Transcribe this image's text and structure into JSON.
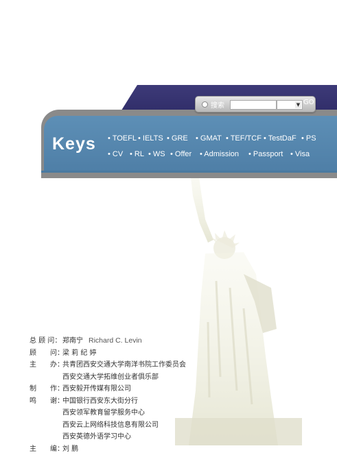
{
  "search": {
    "label": "搜索",
    "input_value": "",
    "select_value": "",
    "go_label": "GO"
  },
  "banner": {
    "title": "Keys",
    "nav_row1": [
      "• TOEFL",
      "• IELTS",
      "• GRE",
      "• GMAT",
      "• TEF/TCF",
      "• TestDaF",
      "• PS"
    ],
    "nav_row2": [
      "• CV",
      "• RL",
      "• WS",
      "• Offer",
      "• Admission",
      "• Passport",
      "• Visa"
    ]
  },
  "credits": [
    {
      "label": "总 顾 问：",
      "value": "郑南宁",
      "extra": "Richard C. Levin"
    },
    {
      "label": "顾　　问：",
      "value": "梁  莉  纪  婷",
      "extra": ""
    },
    {
      "label": "主　　办：",
      "value": "共青团西安交通大学南洋书院工作委员会",
      "extra": ""
    },
    {
      "label": "",
      "value": "西安交通大学拓维创业者俱乐部",
      "extra": ""
    },
    {
      "label": "制　　作：",
      "value": "西安毅开传媒有限公司",
      "extra": ""
    },
    {
      "label": "鸣　　谢：",
      "value": "中国银行西安东大街分行",
      "extra": ""
    },
    {
      "label": "",
      "value": "西安领军教育留学服务中心",
      "extra": ""
    },
    {
      "label": "",
      "value": "西安云上网络科技信息有限公司",
      "extra": ""
    },
    {
      "label": "",
      "value": "西安英德外语学习中心",
      "extra": ""
    },
    {
      "label": "主　　编：",
      "value": "刘  鹏",
      "extra": ""
    }
  ],
  "colors": {
    "banner_dark": "#2e2b66",
    "banner_blue": "#5289b3",
    "banner_gray": "#8a8a8a"
  }
}
